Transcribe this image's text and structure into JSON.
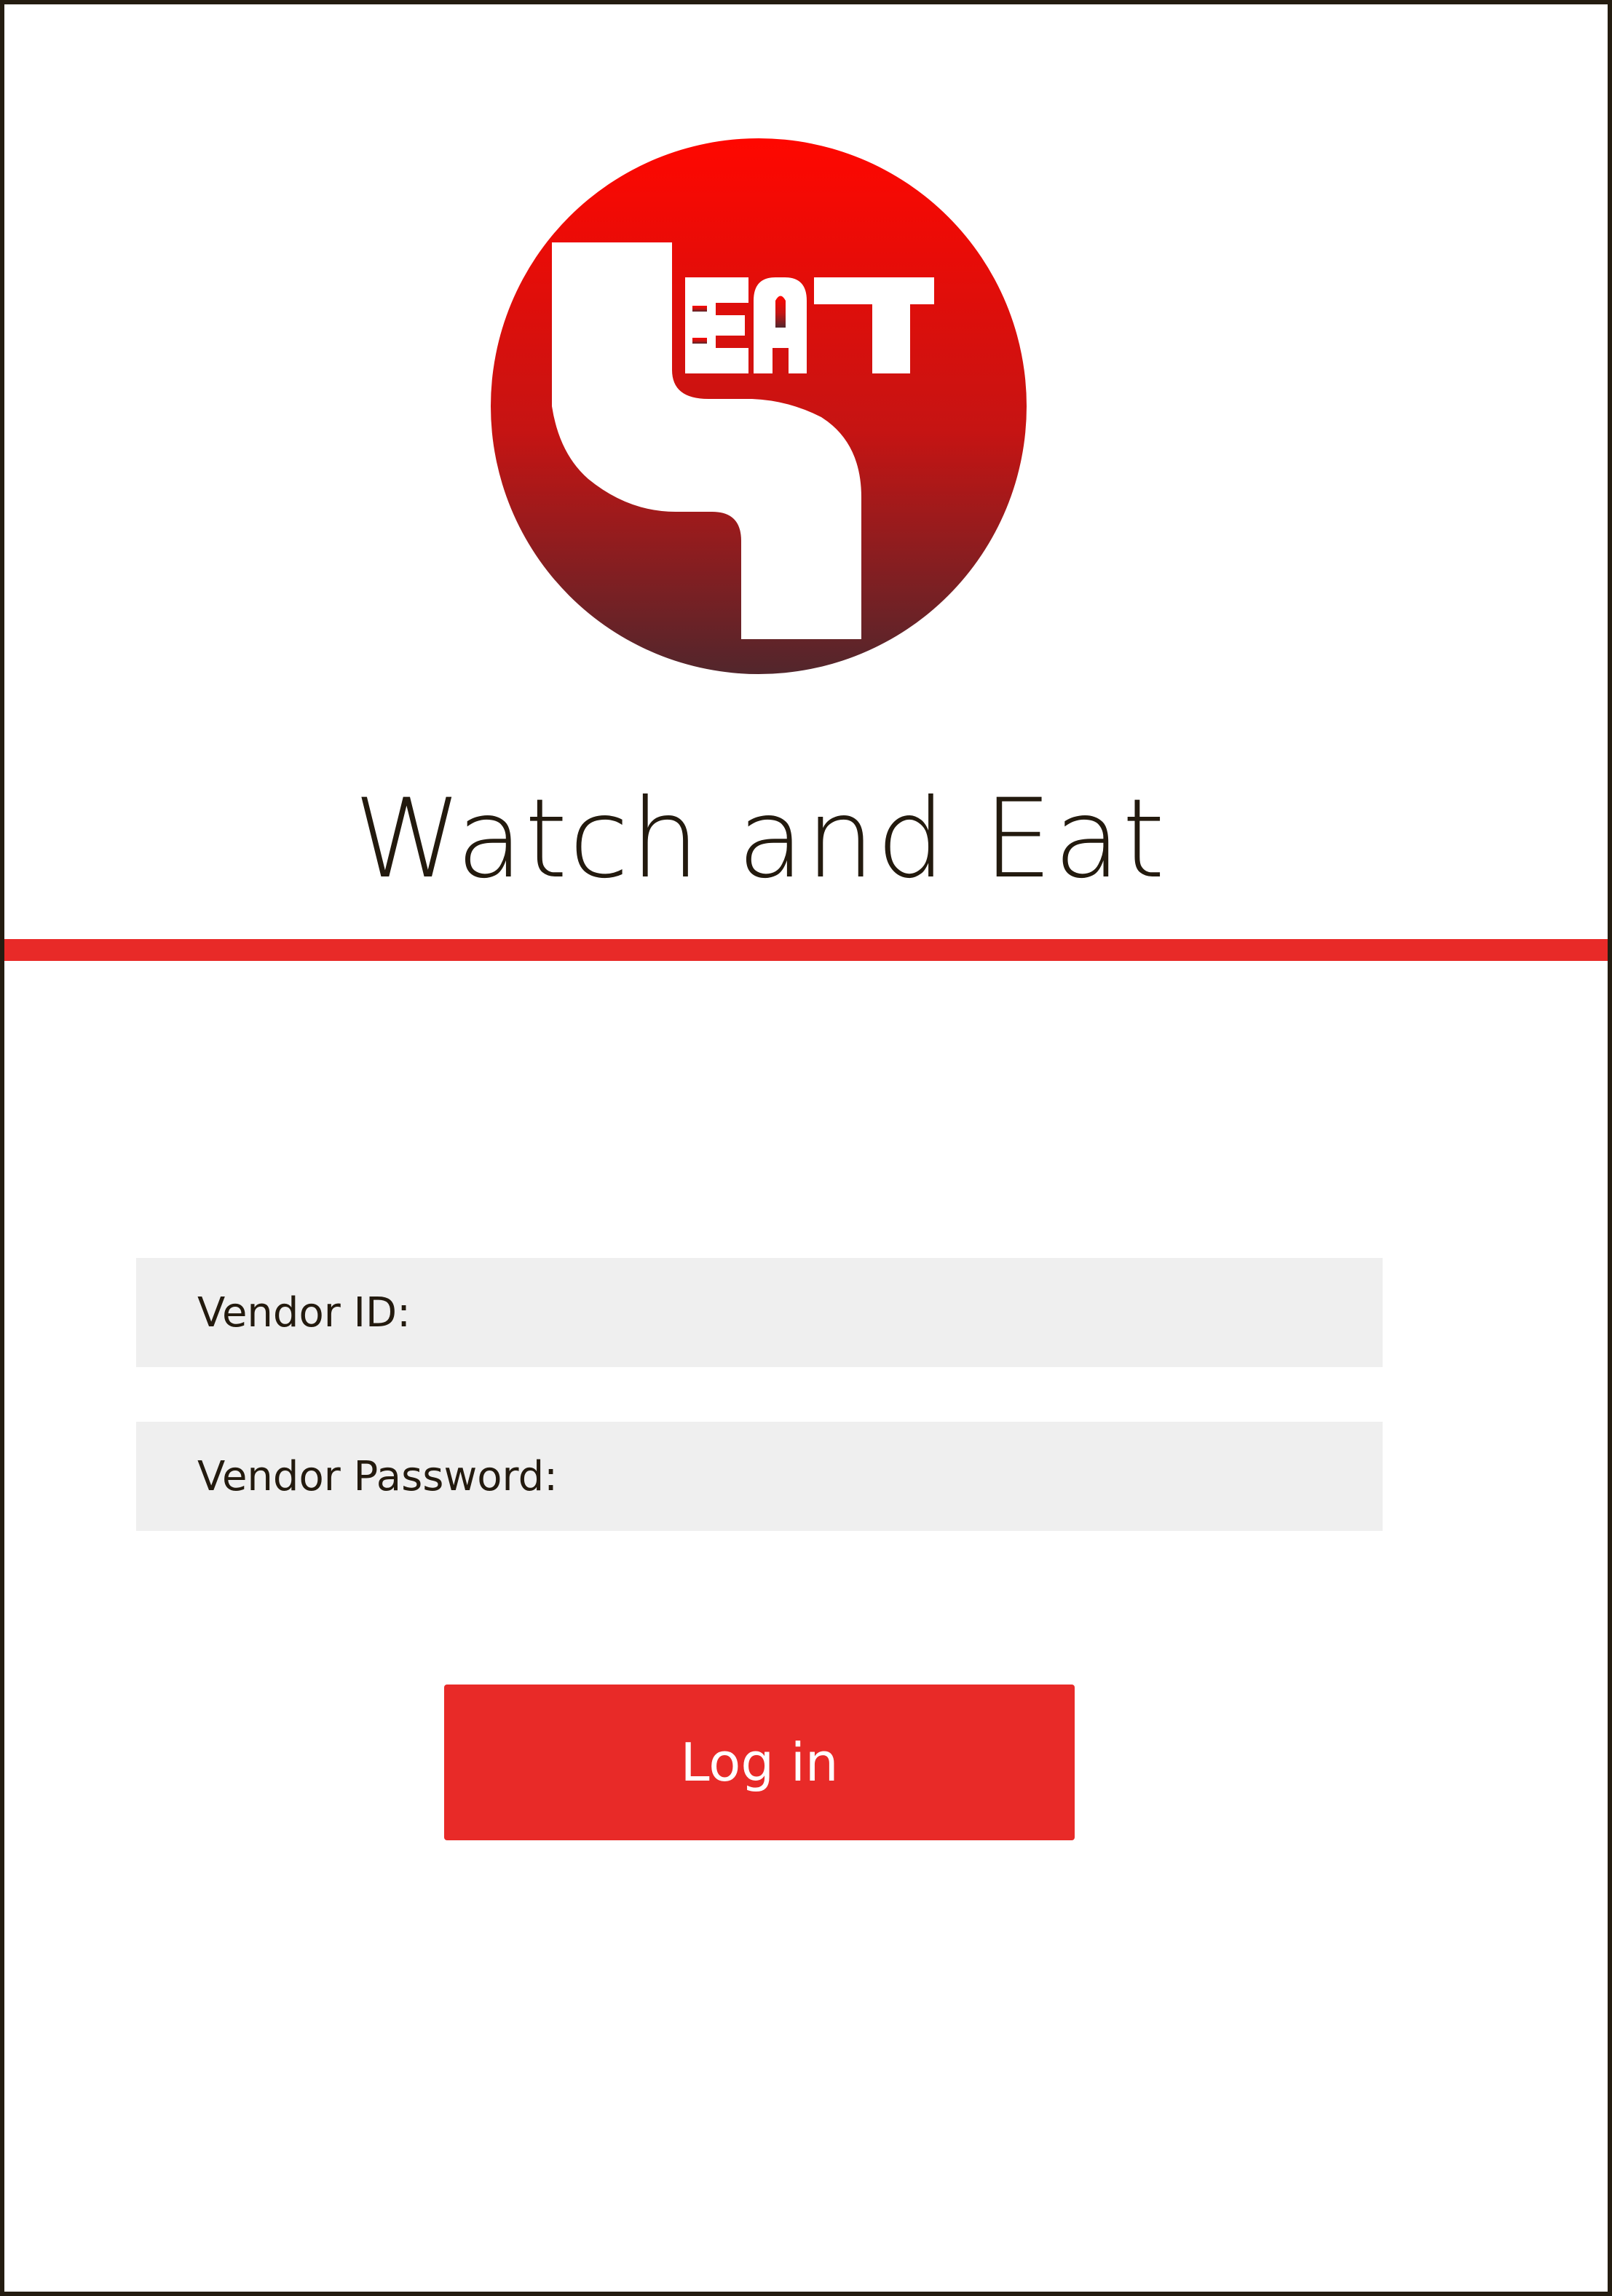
{
  "app": {
    "title": "Watch and Eat",
    "logo_text": "EAT",
    "logo_icon": "eat-logo-icon"
  },
  "form": {
    "vendor_id_label": "Vendor ID:",
    "vendor_password_label": "Vendor Password:",
    "login_label": "Log in"
  },
  "colors": {
    "accent": "#e82a28",
    "logo_gradient_top": "#ff0700",
    "logo_gradient_bottom": "#52262c",
    "field_background": "#efefef",
    "text": "#231a0e",
    "frame_border": "#241c10"
  }
}
